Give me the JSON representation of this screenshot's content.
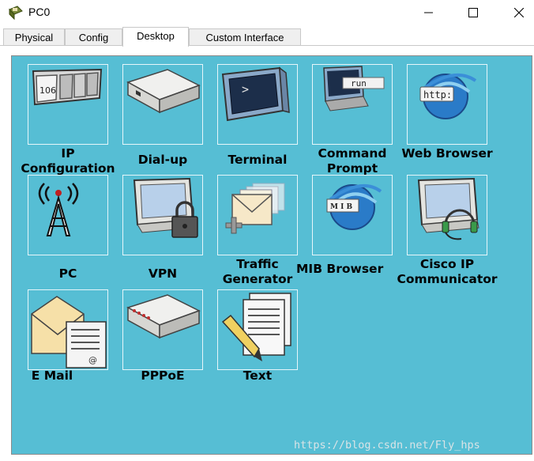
{
  "window": {
    "title": "PC0",
    "minimize_icon": "minimize-icon",
    "maximize_icon": "maximize-icon",
    "close_icon": "close-icon"
  },
  "tabs": [
    {
      "label": "Physical"
    },
    {
      "label": "Config"
    },
    {
      "label": "Desktop",
      "active": true
    },
    {
      "label": "Custom Interface"
    }
  ],
  "desktop": {
    "background_color": "#56bed4",
    "apps": [
      {
        "label": "IP Configuration",
        "icon": "ip-config-icon"
      },
      {
        "label": "Dial-up",
        "icon": "modem-icon"
      },
      {
        "label": "Terminal",
        "icon": "terminal-icon"
      },
      {
        "label": "Command Prompt",
        "icon": "command-prompt-icon",
        "icon_text": "run"
      },
      {
        "label": "Web Browser",
        "icon": "web-browser-icon",
        "icon_text": "http:"
      },
      {
        "label": "PC",
        "icon": "wireless-tower-icon"
      },
      {
        "label": "VPN",
        "icon": "vpn-lock-icon"
      },
      {
        "label": "Traffic Generator",
        "icon": "traffic-generator-icon"
      },
      {
        "label": "MIB Browser",
        "icon": "mib-browser-icon",
        "icon_text": "M I B"
      },
      {
        "label": "Cisco IP Communicator",
        "icon": "ip-communicator-icon"
      },
      {
        "label": "E Mail",
        "icon": "email-icon"
      },
      {
        "label": "PPPoE",
        "icon": "pppoe-icon"
      },
      {
        "label": "Text",
        "icon": "text-editor-icon"
      }
    ],
    "ip_config_icon_text": "106"
  },
  "watermark": "https://blog.csdn.net/Fly_hps"
}
